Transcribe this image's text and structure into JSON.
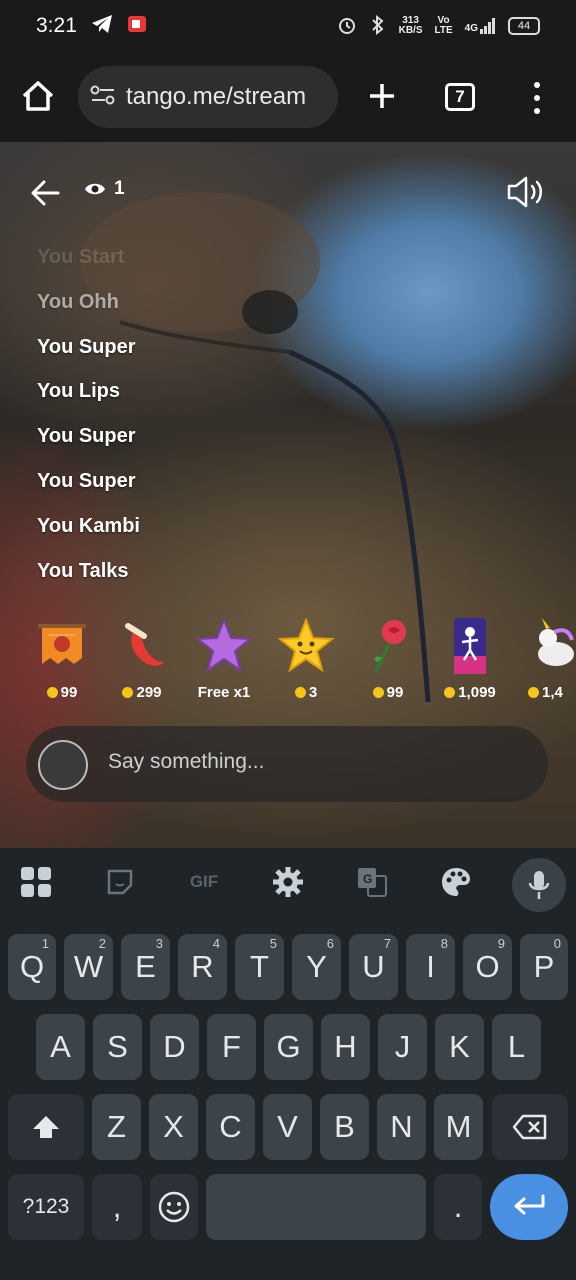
{
  "status_bar": {
    "time": "3:21",
    "net_speed_value": "313",
    "net_speed_unit": "KB/S",
    "volte_top": "Vo",
    "volte_bottom": "LTE",
    "signal": "4G",
    "battery": "44"
  },
  "browser": {
    "url": "tango.me/stream",
    "tab_count": "7"
  },
  "stream": {
    "viewer_count": "1",
    "chat": [
      {
        "text": "You Start"
      },
      {
        "text": "You Ohh"
      },
      {
        "text": "You Super"
      },
      {
        "text": "You Lips"
      },
      {
        "text": "You Super"
      },
      {
        "text": "You Super"
      },
      {
        "text": "You Kambi"
      },
      {
        "text": "You Talks"
      }
    ],
    "gifts": [
      {
        "name": "banner-gift",
        "price": "99"
      },
      {
        "name": "chili-gift",
        "price": "299"
      },
      {
        "name": "purple-star-gift",
        "price": "Free x1"
      },
      {
        "name": "smiling-star-gift",
        "price": "3"
      },
      {
        "name": "rose-gift",
        "price": "99"
      },
      {
        "name": "dancer-gift",
        "price": "1,099"
      },
      {
        "name": "unicorn-gift",
        "price": "1,4"
      }
    ],
    "say_placeholder": "Say something..."
  },
  "keyboard": {
    "gif_label": "GIF",
    "row1": [
      {
        "key": "Q",
        "hint": "1"
      },
      {
        "key": "W",
        "hint": "2"
      },
      {
        "key": "E",
        "hint": "3"
      },
      {
        "key": "R",
        "hint": "4"
      },
      {
        "key": "T",
        "hint": "5"
      },
      {
        "key": "Y",
        "hint": "6"
      },
      {
        "key": "U",
        "hint": "7"
      },
      {
        "key": "I",
        "hint": "8"
      },
      {
        "key": "O",
        "hint": "9"
      },
      {
        "key": "P",
        "hint": "0"
      }
    ],
    "row2": [
      "A",
      "S",
      "D",
      "F",
      "G",
      "H",
      "J",
      "K",
      "L"
    ],
    "row3": [
      "Z",
      "X",
      "C",
      "V",
      "B",
      "N",
      "M"
    ],
    "symbols_label": "?123",
    "comma": ",",
    "period": "."
  },
  "colors": {
    "accent": "#4a90e2",
    "coin": "#f5c518"
  }
}
